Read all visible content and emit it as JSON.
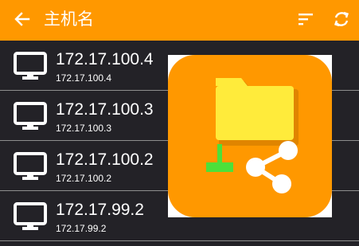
{
  "appbar": {
    "title": "主机名",
    "icons": {
      "back": "back-arrow-icon",
      "sort": "sort-icon",
      "refresh": "refresh-icon"
    }
  },
  "hosts": [
    {
      "name": "172.17.100.4",
      "address": "172.17.100.4",
      "icon": "monitor-icon"
    },
    {
      "name": "172.17.100.3",
      "address": "172.17.100.3",
      "icon": "monitor-icon"
    },
    {
      "name": "172.17.100.2",
      "address": "172.17.100.2",
      "icon": "monitor-icon"
    },
    {
      "name": "172.17.99.2",
      "address": "172.17.99.2",
      "icon": "monitor-icon"
    }
  ],
  "overlay": {
    "icons": [
      "folder-icon",
      "download-icon",
      "share-icon"
    ]
  },
  "colors": {
    "accent": "#FF9800",
    "background": "#232227",
    "divider": "#8E8E8E",
    "text": "#FFFFFF",
    "folder": "#FFEB3B",
    "download": "#4CE03A"
  }
}
